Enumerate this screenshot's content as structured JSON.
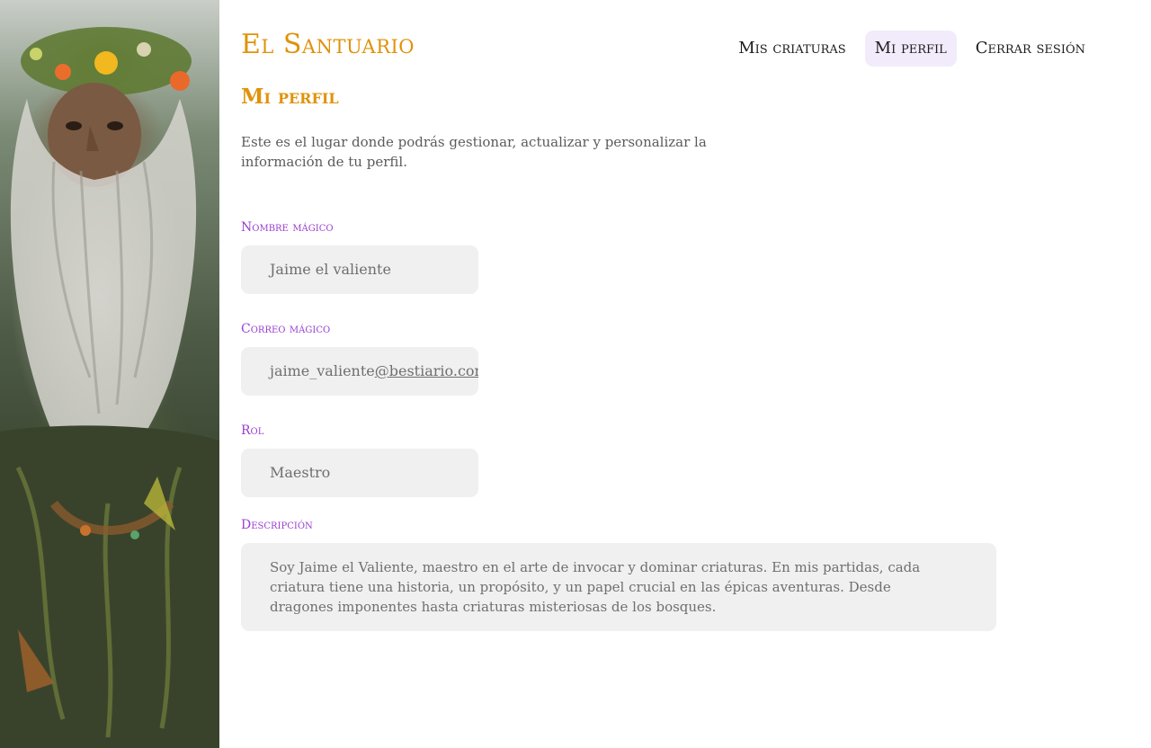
{
  "header": {
    "brand": "El Santuario",
    "nav": [
      {
        "label": "Mis criaturas",
        "active": false
      },
      {
        "label": "Mi perfil",
        "active": true
      },
      {
        "label": "Cerrar sesión",
        "active": false
      }
    ]
  },
  "page": {
    "title": "Mi perfil",
    "intro": "Este es el lugar donde podrás gestionar, actualizar y personalizar la información de tu perfil."
  },
  "form": {
    "name": {
      "label": "Nombre mágico",
      "value": "Jaime el valiente"
    },
    "email": {
      "label": "Correo mágico",
      "value_user": "jaime_valiente",
      "value_domain": "@bestiario.com"
    },
    "role": {
      "label": "Rol",
      "value": "Maestro"
    },
    "description": {
      "label": "Descripción",
      "value": "Soy Jaime el Valiente, maestro en el arte de invocar y dominar criaturas. En mis partidas, cada criatura tiene una historia, un propósito, y un papel crucial en las épicas aventuras. Desde dragones imponentes hasta criaturas misteriosas de los bosques."
    }
  },
  "colors": {
    "brand": "#e0920a",
    "label": "#9a3fd0",
    "active_nav_bg": "#f1ebfb",
    "field_bg": "#f0f0f0"
  },
  "art": {
    "subject": "druid-portrait-illustration"
  }
}
